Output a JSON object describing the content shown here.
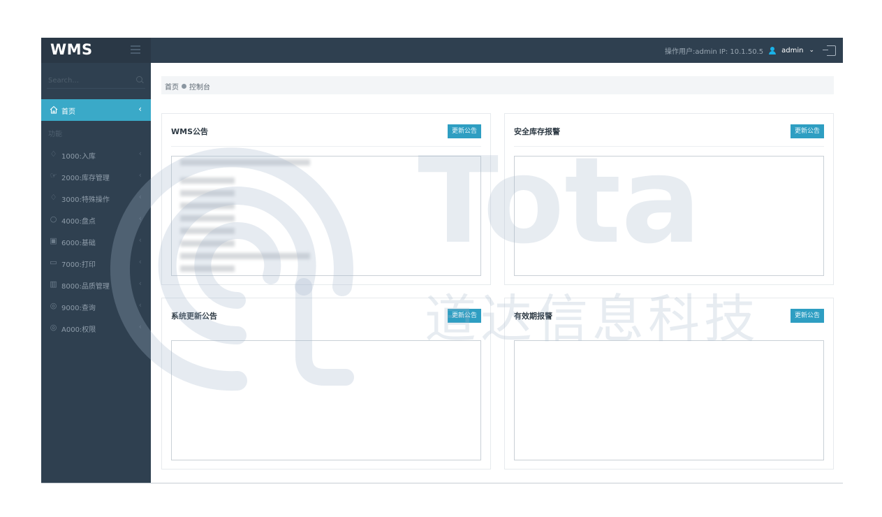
{
  "brand": "WMS",
  "topbar": {
    "operator_info": "操作用户:admin IP: 10.1.50.5",
    "user": "admin",
    "caret": "⌄"
  },
  "sidebar": {
    "search_placeholder": "Search...",
    "home_label": "首页",
    "section_label": "功能",
    "items": [
      {
        "label": "1000:入库",
        "icon": "gem-icon"
      },
      {
        "label": "2000:库存管理",
        "icon": "hand-icon"
      },
      {
        "label": "3000:特殊操作",
        "icon": "gem-icon"
      },
      {
        "label": "4000:盘点",
        "icon": "bulb-icon"
      },
      {
        "label": "6000:基础",
        "icon": "box-icon"
      },
      {
        "label": "7000:打印",
        "icon": "folder-icon"
      },
      {
        "label": "8000:品质管理",
        "icon": "bar-chart-icon"
      },
      {
        "label": "9000:查询",
        "icon": "location-icon"
      },
      {
        "label": "A000:权限",
        "icon": "location-icon"
      }
    ]
  },
  "breadcrumb": {
    "home": "首页",
    "current": "控制台"
  },
  "panels": [
    {
      "title": "WMS公告",
      "button": "更新公告"
    },
    {
      "title": "安全库存报警",
      "button": "更新公告"
    },
    {
      "title": "系统更新公告",
      "button": "更新公告"
    },
    {
      "title": "有效期报警",
      "button": "更新公告"
    }
  ],
  "watermark": {
    "brand": "Tota",
    "company": "道达信息科技"
  }
}
